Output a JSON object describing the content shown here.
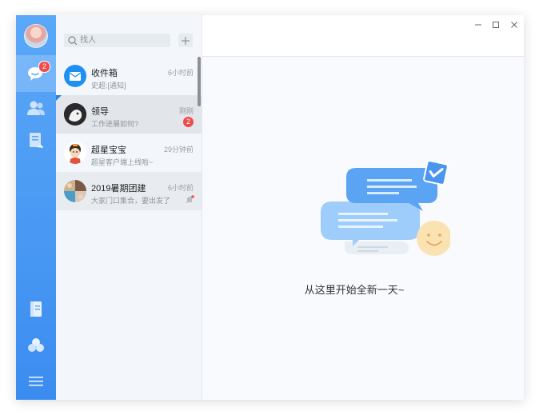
{
  "sidebar": {
    "icons": [
      "avatar",
      "chat-bubble-icon",
      "contacts-icon",
      "document-icon",
      "notebook-icon",
      "apps-cluster-icon",
      "menu-icon"
    ],
    "chat_badge": "2"
  },
  "search": {
    "placeholder": "找人"
  },
  "chats": [
    {
      "name": "收件箱",
      "message": "史超:[通知]",
      "time": "6小时前",
      "badge": ""
    },
    {
      "name": "领导",
      "message": "工作进展如何?",
      "time": "刚刚",
      "badge": "2"
    },
    {
      "name": "超星宝宝",
      "message": "超星客户端上线啦~",
      "time": "29分钟前",
      "badge": ""
    },
    {
      "name": "2019暑期团建",
      "message": "大家门口集合，要出发了",
      "time": "6小时前",
      "badge": ""
    }
  ],
  "empty_state": {
    "text": "从这里开始全新一天~"
  },
  "colors": {
    "rail_top": "#5aa8f8",
    "rail_bottom": "#3b8cf0",
    "badge": "#f04b4b",
    "list_bg": "#f3f7fb",
    "main_bg": "#f8fafd"
  }
}
